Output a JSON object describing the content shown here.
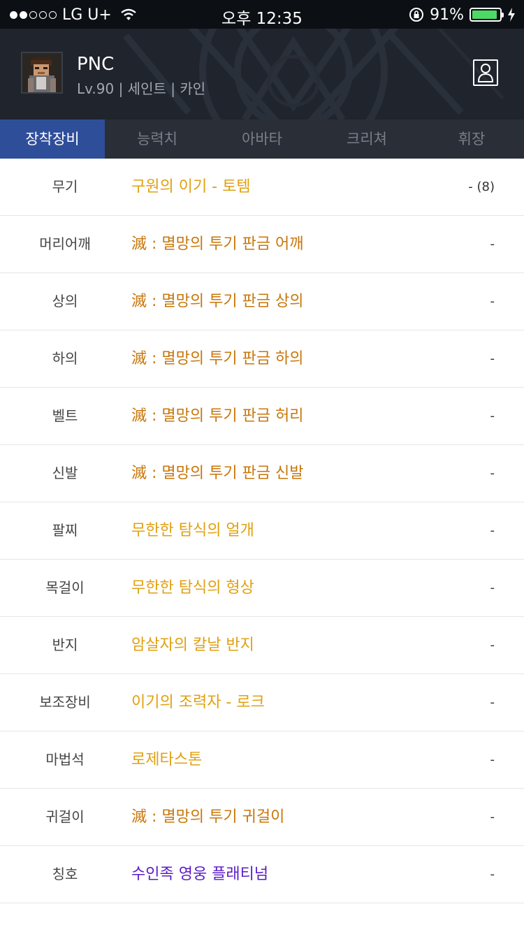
{
  "status_bar": {
    "carrier": "LG U+",
    "time": "오후 12:35",
    "battery_percent": "91%",
    "battery_level": 0.91,
    "signal_bars_filled": 2,
    "signal_bars_total": 5
  },
  "character": {
    "name": "PNC",
    "subtitle": "Lv.90 | 세인트 | 카인"
  },
  "tabs": [
    {
      "label": "장착장비",
      "active": true
    },
    {
      "label": "능력치",
      "active": false
    },
    {
      "label": "아바타",
      "active": false
    },
    {
      "label": "크리쳐",
      "active": false
    },
    {
      "label": "휘장",
      "active": false
    }
  ],
  "colors": {
    "unique": "#e0a010",
    "legendary": "#c8760a",
    "epic_title": "#5a1bc8",
    "active_tab": "#2f4e9a"
  },
  "equipment": [
    {
      "slot": "무기",
      "item": "구원의 이기 - 토템",
      "value": "- (8)",
      "color": "#e0a010"
    },
    {
      "slot": "머리어깨",
      "item": "滅 : 멸망의 투기 판금 어깨",
      "value": "-",
      "color": "#c8760a"
    },
    {
      "slot": "상의",
      "item": "滅 : 멸망의 투기 판금 상의",
      "value": "-",
      "color": "#c8760a"
    },
    {
      "slot": "하의",
      "item": "滅 : 멸망의 투기 판금 하의",
      "value": "-",
      "color": "#c8760a"
    },
    {
      "slot": "벨트",
      "item": "滅 : 멸망의 투기 판금 허리",
      "value": "-",
      "color": "#c8760a"
    },
    {
      "slot": "신발",
      "item": "滅 : 멸망의 투기 판금 신발",
      "value": "-",
      "color": "#c8760a"
    },
    {
      "slot": "팔찌",
      "item": "무한한 탐식의 얼개",
      "value": "-",
      "color": "#e0a010"
    },
    {
      "slot": "목걸이",
      "item": "무한한 탐식의 형상",
      "value": "-",
      "color": "#e0a010"
    },
    {
      "slot": "반지",
      "item": "암살자의 칼날 반지",
      "value": "-",
      "color": "#e0a010"
    },
    {
      "slot": "보조장비",
      "item": "이기의 조력자 - 로크",
      "value": "-",
      "color": "#e0a010"
    },
    {
      "slot": "마법석",
      "item": "로제타스톤",
      "value": "-",
      "color": "#e0a010"
    },
    {
      "slot": "귀걸이",
      "item": "滅 : 멸망의 투기 귀걸이",
      "value": "-",
      "color": "#c8760a"
    },
    {
      "slot": "칭호",
      "item": "수인족 영웅 플래티넘",
      "value": "-",
      "color": "#5a1bc8"
    }
  ]
}
